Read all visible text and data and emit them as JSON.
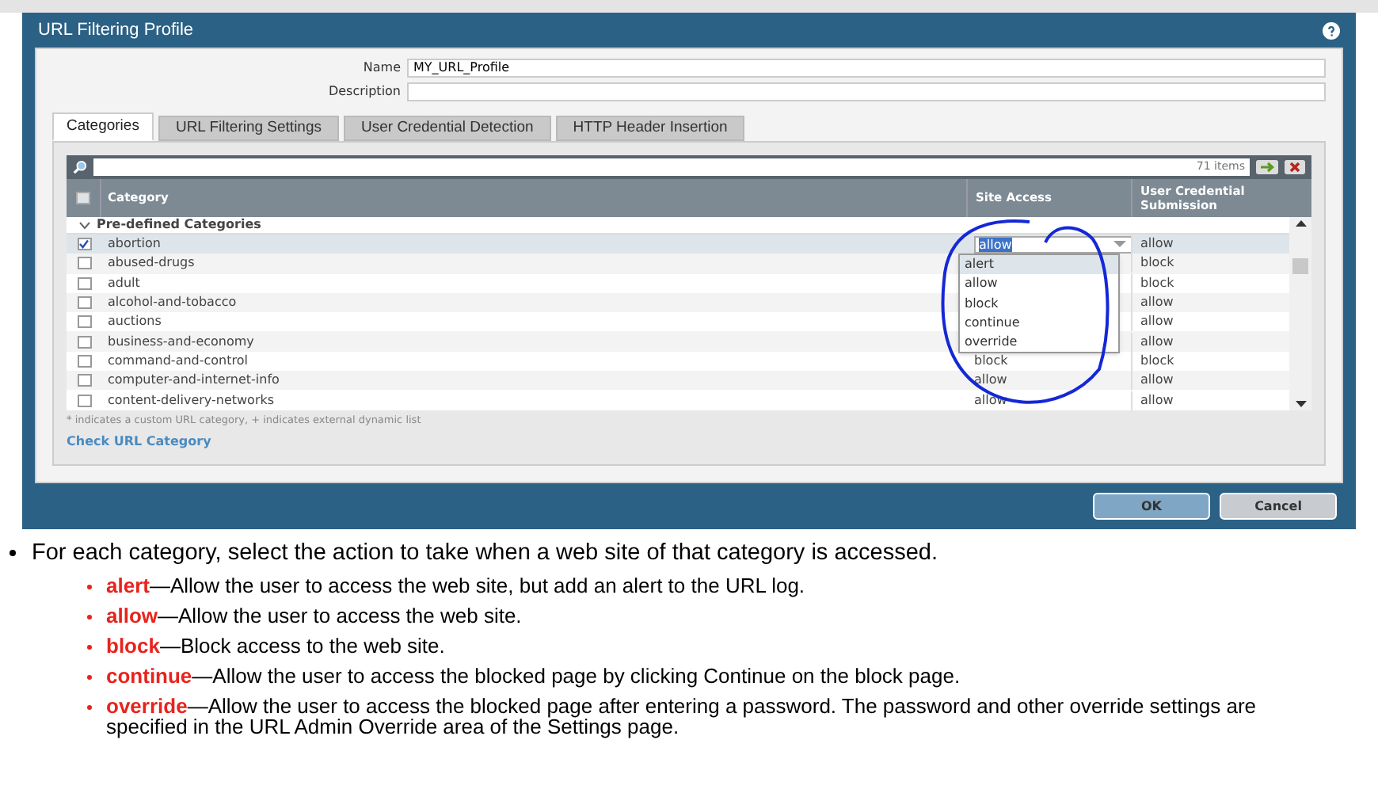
{
  "dialog": {
    "title": "URL Filtering Profile",
    "fields": [
      {
        "label": "Name",
        "value": "MY_URL_Profile"
      },
      {
        "label": "Description"
      }
    ],
    "tabs": [
      {
        "label": "Categories",
        "selected": true
      },
      {
        "label": "URL Filtering Settings",
        "selected": false
      },
      {
        "label": "User Credential Detection",
        "selected": false
      },
      {
        "label": "HTTP Header Insertion",
        "selected": false
      }
    ],
    "item_count": "71 items",
    "table": {
      "all_checked": false,
      "columns": [
        "Category",
        "Site Access",
        "User Credential Submission"
      ],
      "group": "Pre-defined Categories",
      "rows": [
        {
          "category": "abortion",
          "checked": true,
          "selected": true,
          "site_access": "allow",
          "user_credential": "allow"
        },
        {
          "category": "abused-drugs",
          "checked": false,
          "selected": false,
          "user_credential": "block"
        },
        {
          "category": "adult",
          "checked": false,
          "selected": false,
          "user_credential": "block"
        },
        {
          "category": "alcohol-and-tobacco",
          "checked": false,
          "selected": false,
          "user_credential": "allow"
        },
        {
          "category": "auctions",
          "checked": false,
          "selected": false,
          "user_credential": "allow"
        },
        {
          "category": "business-and-economy",
          "checked": false,
          "selected": false,
          "user_credential": "allow"
        },
        {
          "category": "command-and-control",
          "checked": false,
          "selected": false,
          "site_access": "block",
          "user_credential": "block"
        },
        {
          "category": "computer-and-internet-info",
          "checked": false,
          "selected": false,
          "site_access": "allow",
          "user_credential": "allow"
        },
        {
          "category": "content-delivery-networks",
          "checked": false,
          "selected": false,
          "site_access": "allow",
          "user_credential": "allow"
        }
      ]
    },
    "dropdown": {
      "options": [
        {
          "label": "alert",
          "selected": true
        },
        {
          "label": "allow",
          "selected": false
        },
        {
          "label": "block",
          "selected": false
        },
        {
          "label": "continue",
          "selected": false
        },
        {
          "label": "override",
          "selected": false
        }
      ]
    },
    "footnote": "* indicates a custom URL category, + indicates external dynamic list",
    "link": "Check URL Category",
    "buttons": [
      "OK",
      "Cancel"
    ]
  },
  "notes": {
    "intro": "For each category, select the action to take when a web site of that category is accessed.",
    "items": [
      {
        "term": "alert",
        "text": "—Allow the user to access the web site, but add an alert to the URL log."
      },
      {
        "term": "allow",
        "text": "—Allow the user to access the web site."
      },
      {
        "term": "block",
        "text": "—Block access to the web site."
      },
      {
        "term": "continue",
        "text": "—Allow the user to access the blocked page by clicking Continue on the block page."
      },
      {
        "term": "override",
        "text": "—Allow the user to access the blocked page after entering a password. The password and other override settings are specified in the URL Admin Override area of the Settings page."
      }
    ]
  }
}
